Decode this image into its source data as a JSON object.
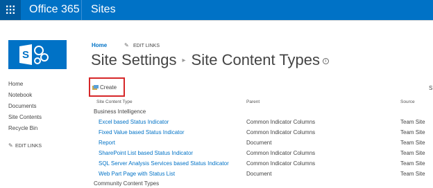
{
  "suite_bar": {
    "app_launcher_icon": "app-launcher-icon",
    "brand": "Office 365",
    "section": "Sites",
    "color": "#0072c6"
  },
  "site_logo": {
    "letter": "S",
    "icon": "sharepoint-logo-icon"
  },
  "left_nav": {
    "items": [
      "Home",
      "Notebook",
      "Documents",
      "Site Contents",
      "Recycle Bin"
    ],
    "edit_links": "EDIT LINKS"
  },
  "top_nav": {
    "home": "Home",
    "edit_links": "EDIT LINKS"
  },
  "title": {
    "part1": "Site Settings",
    "separator": "▸",
    "part2": "Site Content Types",
    "info_glyph": "i"
  },
  "toolbar": {
    "create_label": "Create",
    "highlight_color": "#d62628"
  },
  "right_edge_text": "S",
  "table": {
    "columns": [
      "Site Content Type",
      "Parent",
      "Source"
    ],
    "groups": [
      {
        "name": "Business Intelligence",
        "rows": [
          {
            "name": "Excel based Status Indicator",
            "parent": "Common Indicator Columns",
            "source": "Team Site"
          },
          {
            "name": "Fixed Value based Status Indicator",
            "parent": "Common Indicator Columns",
            "source": "Team Site"
          },
          {
            "name": "Report",
            "parent": "Document",
            "source": "Team Site"
          },
          {
            "name": "SharePoint List based Status Indicator",
            "parent": "Common Indicator Columns",
            "source": "Team Site"
          },
          {
            "name": "SQL Server Analysis Services based Status Indicator",
            "parent": "Common Indicator Columns",
            "source": "Team Site"
          },
          {
            "name": "Web Part Page with Status List",
            "parent": "Document",
            "source": "Team Site"
          }
        ]
      },
      {
        "name": "Community Content Types",
        "rows": []
      }
    ]
  }
}
